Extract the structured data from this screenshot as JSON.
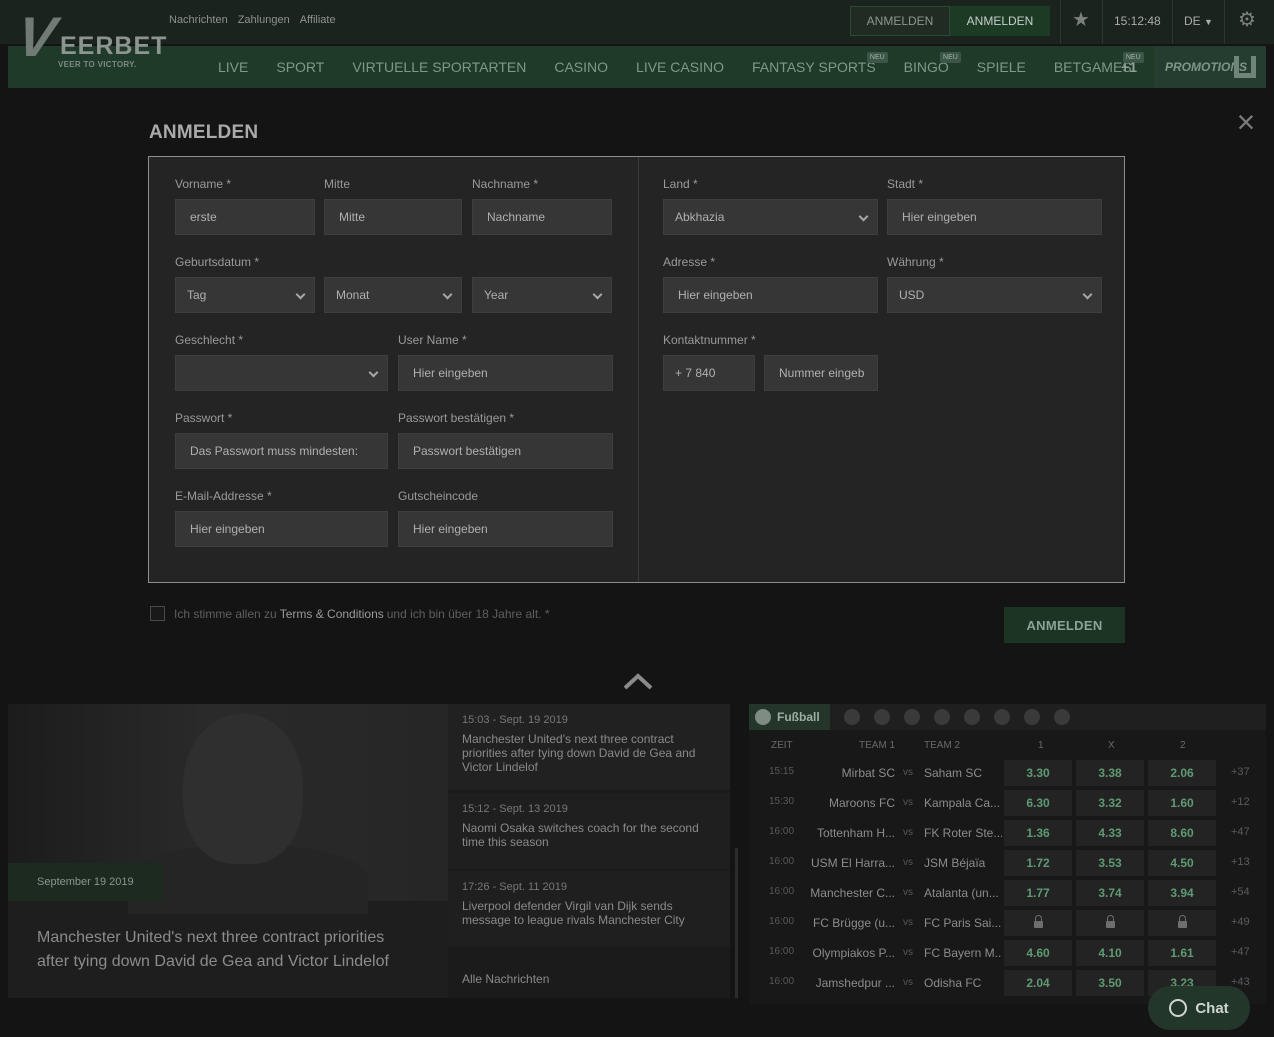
{
  "header": {
    "logo_word": "EERBET",
    "logo_tagline": "VEER TO VICTORY.",
    "top_links": [
      "Nachrichten",
      "Zahlungen",
      "Affiliate"
    ],
    "login_label": "ANMELDEN",
    "signup_label": "ANMELDEN",
    "clock": "15:12:48",
    "language": "DE"
  },
  "nav": {
    "items": [
      {
        "label": "LIVE",
        "badge": ""
      },
      {
        "label": "SPORT",
        "badge": ""
      },
      {
        "label": "VIRTUELLE SPORTARTEN",
        "badge": ""
      },
      {
        "label": "CASINO",
        "badge": ""
      },
      {
        "label": "LIVE CASINO",
        "badge": ""
      },
      {
        "label": "FANTASY SPORTS",
        "badge": "NEU"
      },
      {
        "label": "BINGO",
        "badge": "NEU"
      },
      {
        "label": "SPIELE",
        "badge": ""
      },
      {
        "label": "BETGAMES",
        "badge": "NEU"
      }
    ],
    "more": "+1",
    "promotions": "PROMOTIONS"
  },
  "modal": {
    "title": "ANMELDEN",
    "fields": {
      "vorname": {
        "label": "Vorname *",
        "value": "erste"
      },
      "mitte": {
        "label": "Mitte",
        "placeholder": "Mitte"
      },
      "nachname": {
        "label": "Nachname *",
        "placeholder": "Nachname"
      },
      "geburtsdatum": {
        "label": "Geburtsdatum *",
        "tag": "Tag",
        "monat": "Monat",
        "year": "Year"
      },
      "geschlecht": {
        "label": "Geschlecht *",
        "value": ""
      },
      "username": {
        "label": "User Name *",
        "placeholder": "Hier eingeben"
      },
      "passwort": {
        "label": "Passwort *",
        "placeholder": "Das Passwort muss mindesten:"
      },
      "passwort_bestaetigen": {
        "label": "Passwort bestätigen *",
        "placeholder": "Passwort bestätigen"
      },
      "email": {
        "label": "E-Mail-Addresse *",
        "placeholder": "Hier eingeben"
      },
      "gutschein": {
        "label": "Gutscheincode",
        "placeholder": "Hier eingeben"
      },
      "land": {
        "label": "Land *",
        "value": "Abkhazia"
      },
      "stadt": {
        "label": "Stadt *",
        "placeholder": "Hier eingeben"
      },
      "adresse": {
        "label": "Adresse *",
        "placeholder": "Hier eingeben"
      },
      "waehrung": {
        "label": "Währung *",
        "value": "USD"
      },
      "kontakt": {
        "label": "Kontaktnummer *",
        "prefix": "+ 7 840",
        "placeholder": "Nummer eingeb"
      }
    },
    "terms_before": "Ich stimme allen zu",
    "terms_link": "Terms & Conditions",
    "terms_after": "und ich bin über 18 Jahre alt. *",
    "submit_label": "ANMELDEN"
  },
  "news": {
    "hero_date": "September 19 2019",
    "hero_title": "Manchester United's next three contract priorities after tying down David de Gea and Victor Lindelof",
    "items": [
      {
        "time": "15:03 - Sept. 19 2019",
        "headline": "Manchester United's next three contract priorities after tying down David de Gea and Victor Lindelof"
      },
      {
        "time": "15:12 - Sept. 13 2019",
        "headline": "Naomi Osaka switches coach for the second time this season"
      },
      {
        "time": "17:26 - Sept. 11 2019",
        "headline": "Liverpool defender Virgil van Dijk sends message to league rivals Manchester City"
      }
    ],
    "all_label": "Alle Nachrichten"
  },
  "odds": {
    "sport_label": "Fußball",
    "headers": {
      "zeit": "ZEIT",
      "team1": "TEAM 1",
      "team2": "TEAM 2",
      "o1": "1",
      "ox": "X",
      "o2": "2"
    },
    "vs": "vs",
    "rows": [
      {
        "time": "15:15",
        "team1": "Mirbat SC",
        "team2": "Saham SC",
        "o1": "3.30",
        "ox": "3.38",
        "o2": "2.06",
        "more": "+37",
        "locked": false
      },
      {
        "time": "15:30",
        "team1": "Maroons FC",
        "team2": "Kampala Ca...",
        "o1": "6.30",
        "ox": "3.32",
        "o2": "1.60",
        "more": "+12",
        "locked": false
      },
      {
        "time": "16:00",
        "team1": "Tottenham H...",
        "team2": "FK Roter Ste...",
        "o1": "1.36",
        "ox": "4.33",
        "o2": "8.60",
        "more": "+47",
        "locked": false
      },
      {
        "time": "16:00",
        "team1": "USM El Harra...",
        "team2": "JSM Béjaïa",
        "o1": "1.72",
        "ox": "3.53",
        "o2": "4.50",
        "more": "+13",
        "locked": false
      },
      {
        "time": "16:00",
        "team1": "Manchester C...",
        "team2": "Atalanta (un...",
        "o1": "1.77",
        "ox": "3.74",
        "o2": "3.94",
        "more": "+54",
        "locked": false
      },
      {
        "time": "16:00",
        "team1": "FC Brügge (u...",
        "team2": "FC Paris Sai...",
        "o1": "",
        "ox": "",
        "o2": "",
        "more": "+49",
        "locked": true
      },
      {
        "time": "16:00",
        "team1": "Olympiakos P...",
        "team2": "FC Bayern M...",
        "o1": "4.60",
        "ox": "4.10",
        "o2": "1.61",
        "more": "+47",
        "locked": false
      },
      {
        "time": "16:00",
        "team1": "Jamshedpur ...",
        "team2": "Odisha FC",
        "o1": "2.04",
        "ox": "3.50",
        "o2": "3.23",
        "more": "+43",
        "locked": false
      }
    ]
  },
  "chat_label": "Chat"
}
